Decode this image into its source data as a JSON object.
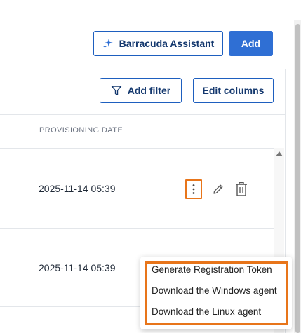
{
  "toolbar": {
    "assistant_label": "Barracuda Assistant",
    "add_label": "Add",
    "filter_label": "Add filter",
    "columns_label": "Edit columns"
  },
  "table": {
    "columns": [
      "PROVISIONING DATE"
    ],
    "rows": [
      {
        "provisioning_date": "2025-11-14 05:39"
      },
      {
        "provisioning_date": "2025-11-14 05:39"
      }
    ]
  },
  "row_menu": {
    "items": [
      "Generate Registration Token",
      "Download the Windows agent",
      "Download the Linux agent"
    ]
  },
  "colors": {
    "primary": "#2f6fd4",
    "outline_text": "#14386e",
    "highlight": "#e8751a"
  },
  "icons": {
    "assistant": "sparkle-icon",
    "filter": "funnel-icon",
    "row_menu": "kebab-icon",
    "edit": "pencil-icon",
    "delete": "trash-icon"
  }
}
